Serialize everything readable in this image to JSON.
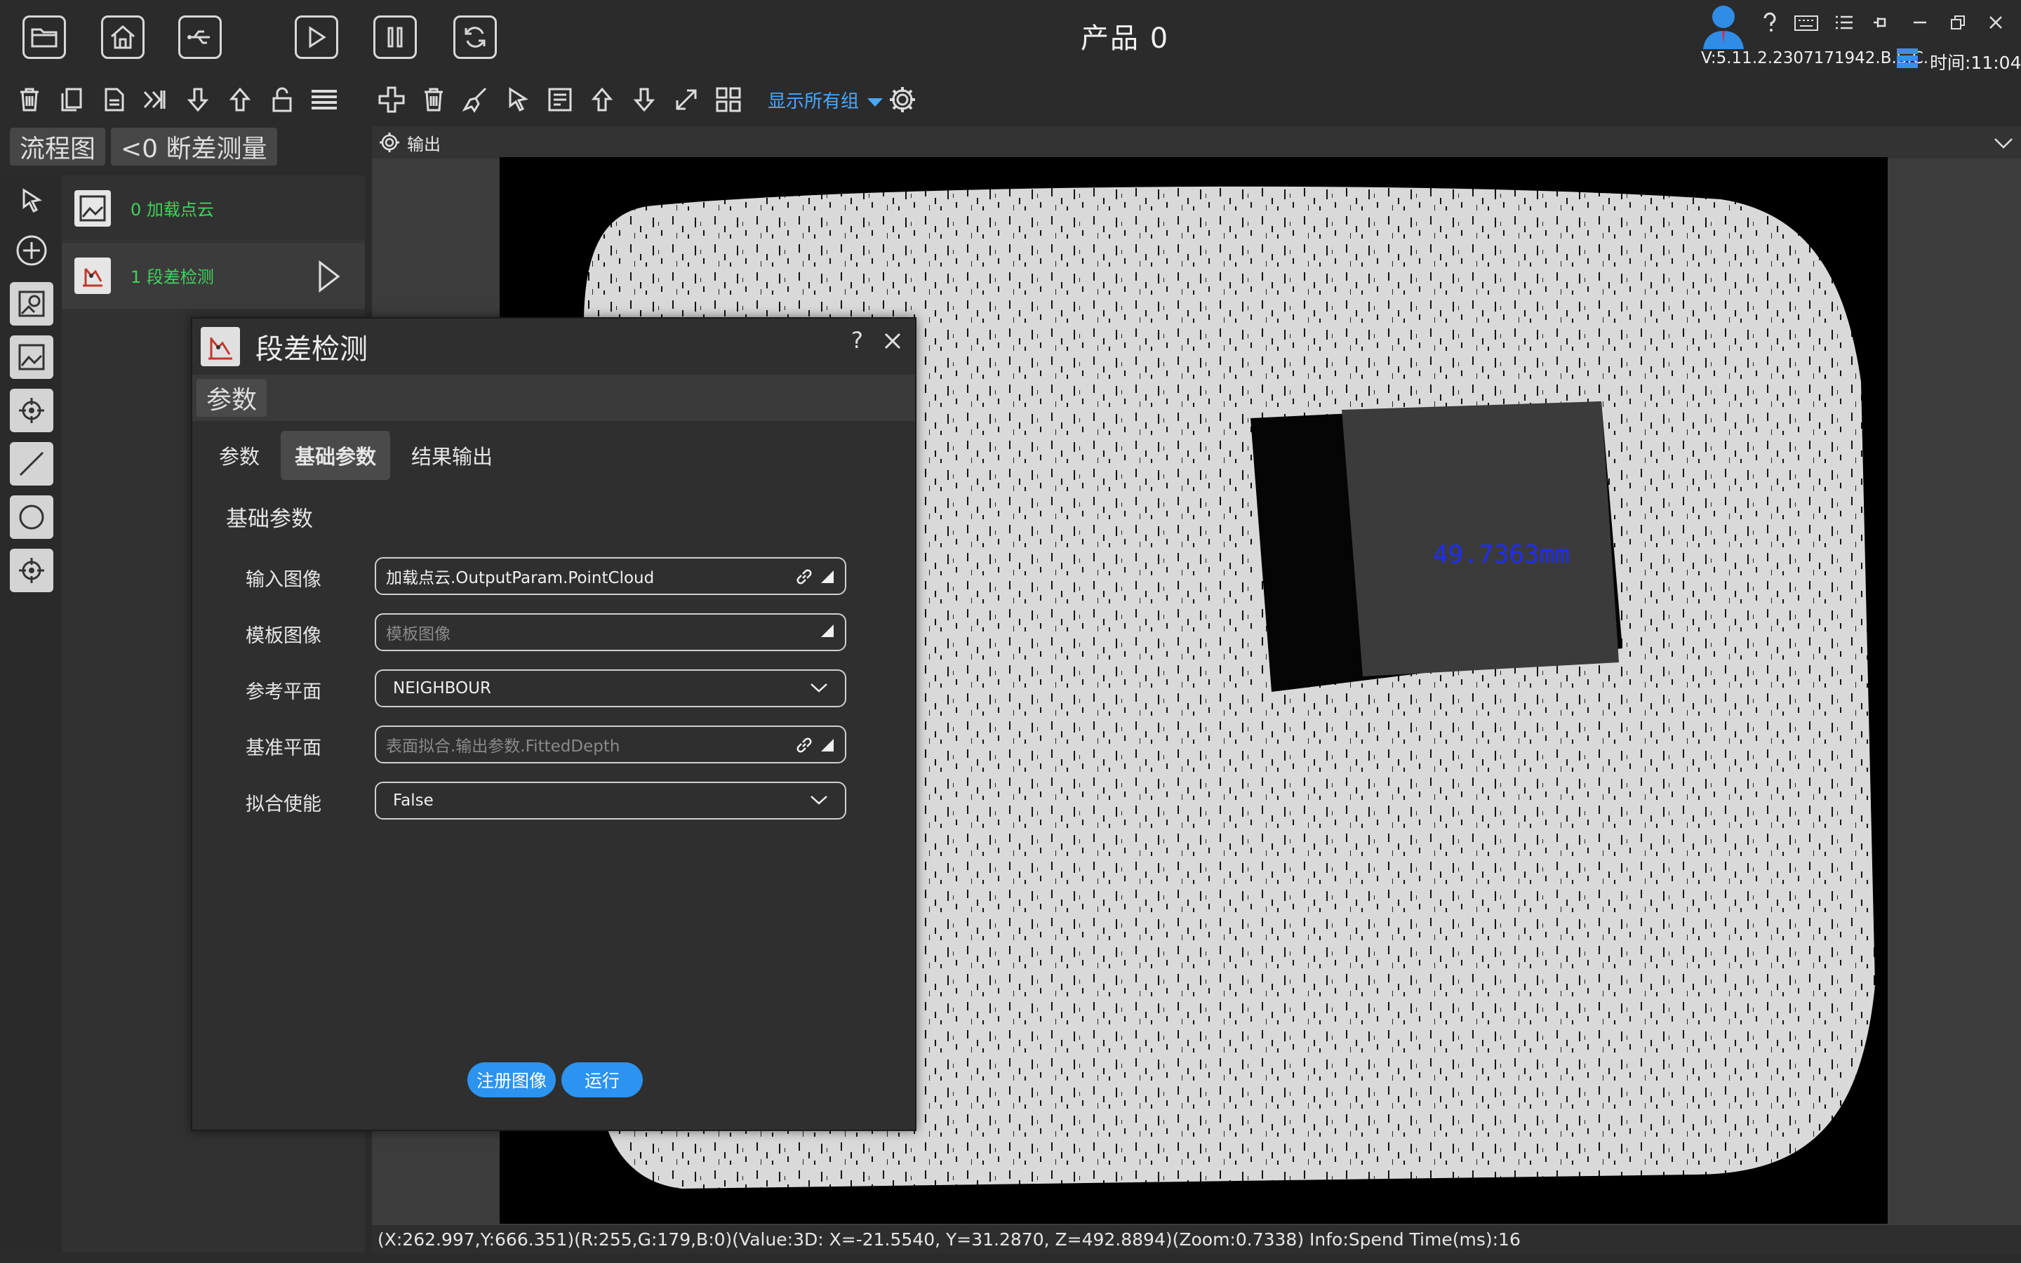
{
  "window": {
    "title": "产品  0",
    "version": "V:5.11.2.2307171942.B.S.C.",
    "clock": "时间:11:04"
  },
  "toolbar": {
    "group_dropdown": "显示所有组"
  },
  "tabs": [
    {
      "label": "流程图"
    },
    {
      "label": "<0  断差测量"
    }
  ],
  "flow": {
    "items": [
      {
        "label": "0  加载点云"
      },
      {
        "label": "1  段差检测"
      }
    ]
  },
  "output": {
    "label": "输出",
    "measurement": "49.7363mm"
  },
  "statusbar": {
    "text": "(X:262.997,Y:666.351)(R:255,G:179,B:0)(Value:3D: X=-21.5540, Y=31.2870, Z=492.8894)(Zoom:0.7338)   Info:Spend Time(ms):16"
  },
  "dialog": {
    "title": "段差检测",
    "help": "?",
    "sub_label": "参数",
    "tabs": [
      {
        "label": "参数"
      },
      {
        "label": "基础参数"
      },
      {
        "label": "结果输出"
      }
    ],
    "section_title": "基础参数",
    "fields": [
      {
        "label": "输入图像",
        "value": "加载点云.OutputParam.PointCloud",
        "placeholder": ""
      },
      {
        "label": "模板图像",
        "value": "",
        "placeholder": "模板图像"
      },
      {
        "label": "参考平面",
        "value": "NEIGHBOUR",
        "placeholder": ""
      },
      {
        "label": "基准平面",
        "value": "",
        "placeholder": "表面拟合.输出参数.FittedDepth"
      },
      {
        "label": "拟合使能",
        "value": "False",
        "placeholder": ""
      }
    ],
    "register_button": "注册图像",
    "run_button": "运行"
  },
  "colors": {
    "accent": "#2c93f0",
    "flow_text": "#3fd35b",
    "measure_text": "#1f2cff",
    "dropdown_text": "#4aa8ff"
  }
}
